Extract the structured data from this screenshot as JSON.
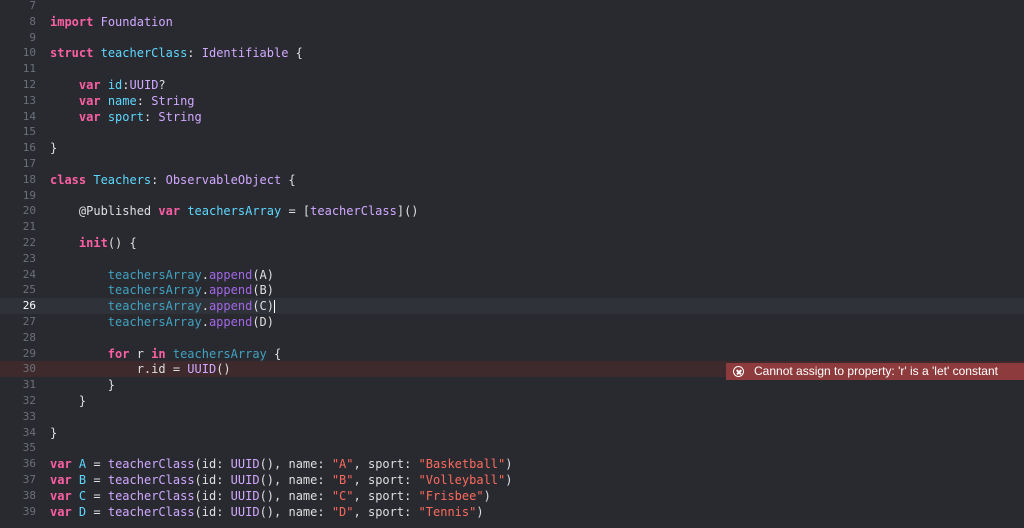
{
  "editor": {
    "current_line": "26",
    "lines": [
      {
        "num": "7",
        "text": ""
      },
      {
        "num": "8",
        "text": "import Foundation"
      },
      {
        "num": "9",
        "text": ""
      },
      {
        "num": "10",
        "text": "struct teacherClass: Identifiable {"
      },
      {
        "num": "11",
        "text": ""
      },
      {
        "num": "12",
        "text": "    var id:UUID?"
      },
      {
        "num": "13",
        "text": "    var name: String"
      },
      {
        "num": "14",
        "text": "    var sport: String"
      },
      {
        "num": "15",
        "text": ""
      },
      {
        "num": "16",
        "text": "}"
      },
      {
        "num": "17",
        "text": ""
      },
      {
        "num": "18",
        "text": "class Teachers: ObservableObject {"
      },
      {
        "num": "19",
        "text": ""
      },
      {
        "num": "20",
        "text": "    @Published var teachersArray = [teacherClass]()"
      },
      {
        "num": "21",
        "text": ""
      },
      {
        "num": "22",
        "text": "    init() {"
      },
      {
        "num": "23",
        "text": ""
      },
      {
        "num": "24",
        "text": "        teachersArray.append(A)"
      },
      {
        "num": "25",
        "text": "        teachersArray.append(B)"
      },
      {
        "num": "26",
        "text": "        teachersArray.append(C)"
      },
      {
        "num": "27",
        "text": "        teachersArray.append(D)"
      },
      {
        "num": "28",
        "text": ""
      },
      {
        "num": "29",
        "text": "        for r in teachersArray {"
      },
      {
        "num": "30",
        "text": "            r.id = UUID()"
      },
      {
        "num": "31",
        "text": "        }"
      },
      {
        "num": "32",
        "text": "    }"
      },
      {
        "num": "33",
        "text": ""
      },
      {
        "num": "34",
        "text": "}"
      },
      {
        "num": "35",
        "text": ""
      },
      {
        "num": "36",
        "text": "var A = teacherClass(id: UUID(), name: \"A\", sport: \"Basketball\")"
      },
      {
        "num": "37",
        "text": "var B = teacherClass(id: UUID(), name: \"B\", sport: \"Volleyball\")"
      },
      {
        "num": "38",
        "text": "var C = teacherClass(id: UUID(), name: \"C\", sport: \"Frisbee\")"
      },
      {
        "num": "39",
        "text": "var D = teacherClass(id: UUID(), name: \"D\", sport: \"Tennis\")"
      }
    ]
  },
  "error": {
    "line": "30",
    "message": "Cannot assign to property: 'r' is a 'let' constant",
    "icon": "error-circle-x-icon",
    "color": "#8e3b3d"
  },
  "theme": {
    "background": "#292a30",
    "keyword": "#fc5fa3",
    "string": "#fc6a5d",
    "type": "#d0a8ff"
  }
}
